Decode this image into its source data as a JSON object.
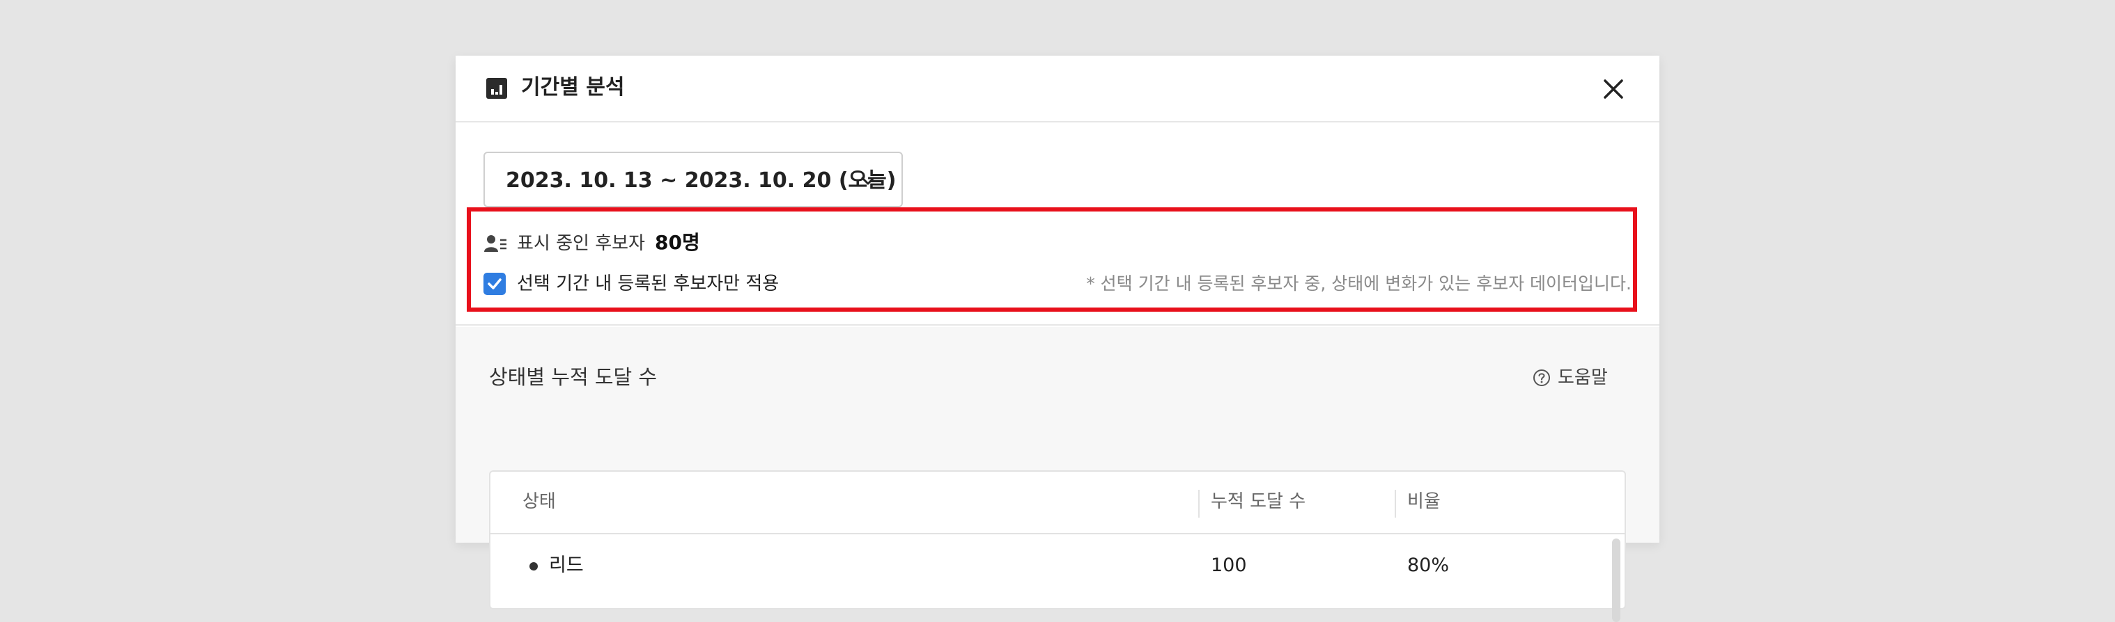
{
  "modal": {
    "title": "기간별 분석",
    "icons": {
      "title_icon": "bar-chart-icon",
      "close": "close-icon"
    }
  },
  "filter": {
    "date_range": "2023. 10. 13 ~ 2023. 10. 20 (오늘)",
    "candidates_label": "표시 중인 후보자",
    "candidates_count": "80명",
    "checkbox_label": "선택 기간 내 등록된 후보자만 적용",
    "checkbox_checked": true,
    "note": "* 선택 기간 내 등록된 후보자 중, 상태에 변화가 있는 후보자 데이터입니다.",
    "highlight_color": "#e8101b",
    "checkbox_color": "#2f7de1"
  },
  "section": {
    "title": "상태별 누적 도달 수",
    "help_label": "도움말"
  },
  "table": {
    "headers": [
      "상태",
      "누적 도달 수",
      "비율"
    ],
    "rows": [
      {
        "status": "리드",
        "count": "100",
        "ratio": "80%"
      }
    ]
  }
}
